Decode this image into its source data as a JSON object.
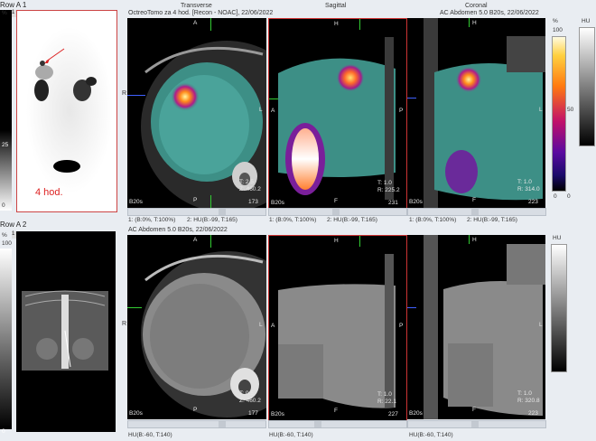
{
  "row1": {
    "label": "Row A 1",
    "index": "1",
    "mip": {
      "percent_label": "%",
      "scale_top": "50",
      "scale_mid": "25",
      "scale_bottom": "0",
      "time_label": "4 hod."
    },
    "header_left": "OctreoTomo za 4 hod. [Recon - NOAC], 22/06/2022",
    "header_right": "AC Abdomen 5.0 B20s, 22/06/2022",
    "view_transverse": "Transverse",
    "view_sagittal": "Sagittal",
    "view_coronal": "Coronal",
    "colorbar": {
      "percent": "%",
      "top": "100",
      "bottom": "0"
    },
    "hu_scale": {
      "label": "HU",
      "top": "50",
      "bottom": "0"
    },
    "transverse": {
      "top": "A",
      "left": "R",
      "right": "L",
      "bottom": "P",
      "t_info": "T: 2.5",
      "z_info": "Z: 460.2",
      "series": "B20s",
      "count": "173"
    },
    "sagittal": {
      "top": "H",
      "left": "A",
      "right": "P",
      "bottom": "F",
      "t_info": "T: 1.0",
      "z_info": "R: 225.2",
      "series": "B20s",
      "count": "231"
    },
    "coronal": {
      "top": "H",
      "left": "R",
      "right": "L",
      "bottom": "F",
      "t_info": "T: 1.0",
      "z_info": "R: 314.0",
      "series": "B20s",
      "count": "223"
    },
    "window_bar": {
      "t1": "1: (B:0%, T:100%)",
      "t2": "2: HU(B:-99, T:165)",
      "s1": "1: (B:0%, T:100%)",
      "s2": "2: HU(B:-99, T:165)",
      "c1": "1: (B:0%, T:100%)",
      "c2": "2: HU(B:-99, T:165)"
    }
  },
  "row2": {
    "label": "Row A 2",
    "index": "1",
    "scout": {
      "percent_label": "%",
      "scale_top": "100",
      "scale_bottom": "0"
    },
    "header_left": "AC Abdomen 5.0 B20s, 22/06/2022",
    "hu_label": "HU",
    "transverse": {
      "top": "A",
      "left": "R",
      "right": "L",
      "bottom": "P",
      "t_info": "T: 0.5",
      "z_info": "Z: 460.2",
      "series": "B20s",
      "count": "177"
    },
    "sagittal": {
      "top": "H",
      "left": "A",
      "right": "P",
      "bottom": "F",
      "t_info": "T: 1.0",
      "z_info": "R: 22.1",
      "series": "B20s",
      "count": "227"
    },
    "coronal": {
      "top": "H",
      "left": "R",
      "right": "L",
      "bottom": "F",
      "t_info": "T: 1.0",
      "z_info": "R: 320.8",
      "series": "B20s",
      "count": "223"
    },
    "window_bar": {
      "t": "HU(B:-60, T:140)",
      "s": "HU(B:-60, T:140)",
      "c": "HU(B:-60, T:140)"
    }
  }
}
